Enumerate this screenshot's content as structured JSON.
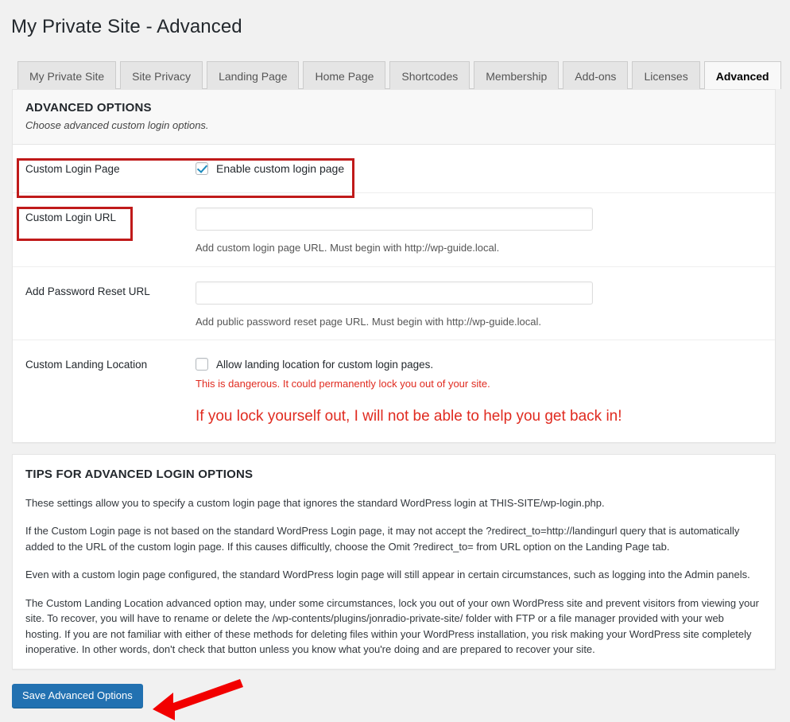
{
  "page": {
    "title": "My Private Site - Advanced"
  },
  "tabs": [
    {
      "label": "My Private Site",
      "active": false
    },
    {
      "label": "Site Privacy",
      "active": false
    },
    {
      "label": "Landing Page",
      "active": false
    },
    {
      "label": "Home Page",
      "active": false
    },
    {
      "label": "Shortcodes",
      "active": false
    },
    {
      "label": "Membership",
      "active": false
    },
    {
      "label": "Add-ons",
      "active": false
    },
    {
      "label": "Licenses",
      "active": false
    },
    {
      "label": "Advanced",
      "active": true
    }
  ],
  "advanced_options": {
    "heading": "ADVANCED OPTIONS",
    "subheading": "Choose advanced custom login options.",
    "rows": {
      "custom_login_page": {
        "label": "Custom Login Page",
        "checkbox_label": "Enable custom login page",
        "checked": true
      },
      "custom_login_url": {
        "label": "Custom Login URL",
        "value": "",
        "placeholder": "",
        "help": "Add custom login page URL. Must begin with http://wp-guide.local."
      },
      "password_reset_url": {
        "label": "Add Password Reset URL",
        "value": "",
        "placeholder": "",
        "help": "Add public password reset page URL. Must begin with http://wp-guide.local."
      },
      "custom_landing_location": {
        "label": "Custom Landing Location",
        "checkbox_label": "Allow landing location for custom login pages.",
        "checked": false,
        "warning_small": "This is dangerous. It could permanently lock you out of your site.",
        "warning_big": "If you lock yourself out, I will not be able to help you get back in!"
      }
    }
  },
  "tips": {
    "heading": "TIPS FOR ADVANCED LOGIN OPTIONS",
    "paragraphs": [
      "These settings allow you to specify a custom login page that ignores the standard WordPress login at THIS-SITE/wp-login.php.",
      "If the Custom Login page is not based on the standard WordPress Login page, it may not accept the ?redirect_to=http://landingurl query that is automatically added to the URL of the custom login page. If this causes difficultly, choose the Omit ?redirect_to= from URL option on the Landing Page tab.",
      "Even with a custom login page configured, the standard WordPress login page will still appear in certain circumstances, such as logging into the Admin panels.",
      "The Custom Landing Location advanced option may, under some circumstances, lock you out of your own WordPress site and prevent visitors from viewing your site. To recover, you will have to rename or delete the /wp-contents/plugins/jonradio-private-site/ folder with FTP or a file manager provided with your web hosting. If you are not familiar with either of these methods for deleting files within your WordPress installation, you risk making your WordPress site completely inoperative. In other words, don't check that button unless you know what you're doing and are prepared to recover your site."
    ]
  },
  "footer": {
    "save_label": "Save Advanced Options"
  },
  "colors": {
    "highlight_red": "#c01a1a",
    "warning_red": "#e02b20",
    "arrow_red": "#f20000",
    "primary_button": "#2271b1",
    "checkbox_check": "#1e8cbe"
  }
}
